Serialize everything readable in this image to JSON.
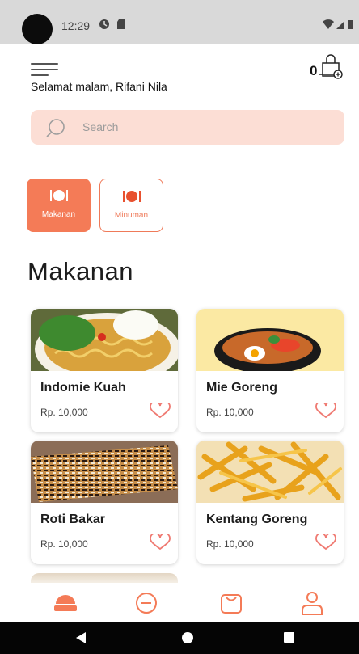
{
  "status_bar": {
    "time": "12:29",
    "icons": [
      "sync-icon",
      "sd-card-icon",
      "wifi-icon",
      "signal-icon",
      "battery-icon"
    ]
  },
  "header": {
    "greeting": "Selamat malam, Rifani Nila",
    "cart_count": "0",
    "menu_icon": "hamburger-menu-icon",
    "cart_icon": "shopping-bag-icon"
  },
  "search": {
    "placeholder": "Search"
  },
  "categories": [
    {
      "label": "Makanan",
      "icon": "dish-icon",
      "active": true
    },
    {
      "label": "Minuman",
      "icon": "dish-icon",
      "active": false
    }
  ],
  "section_title": "Makanan",
  "products": [
    {
      "name": "Indomie Kuah",
      "price": "Rp. 10,000",
      "image": "noodle-soup-photo"
    },
    {
      "name": "Mie Goreng",
      "price": "Rp. 10,000",
      "image": "fried-noodle-photo"
    },
    {
      "name": "Roti Bakar",
      "price": "Rp. 10,000",
      "image": "toast-photo"
    },
    {
      "name": "Kentang Goreng",
      "price": "Rp. 10,000",
      "image": "french-fries-photo"
    }
  ],
  "bottom_nav": [
    "home-icon",
    "promo-icon",
    "orders-icon",
    "profile-icon"
  ],
  "system_nav": [
    "back-icon",
    "home-circle-icon",
    "recents-icon"
  ],
  "colors": {
    "accent": "#f47b57",
    "search_bg": "#fcded5",
    "status_bar": "#d9d9d9"
  }
}
